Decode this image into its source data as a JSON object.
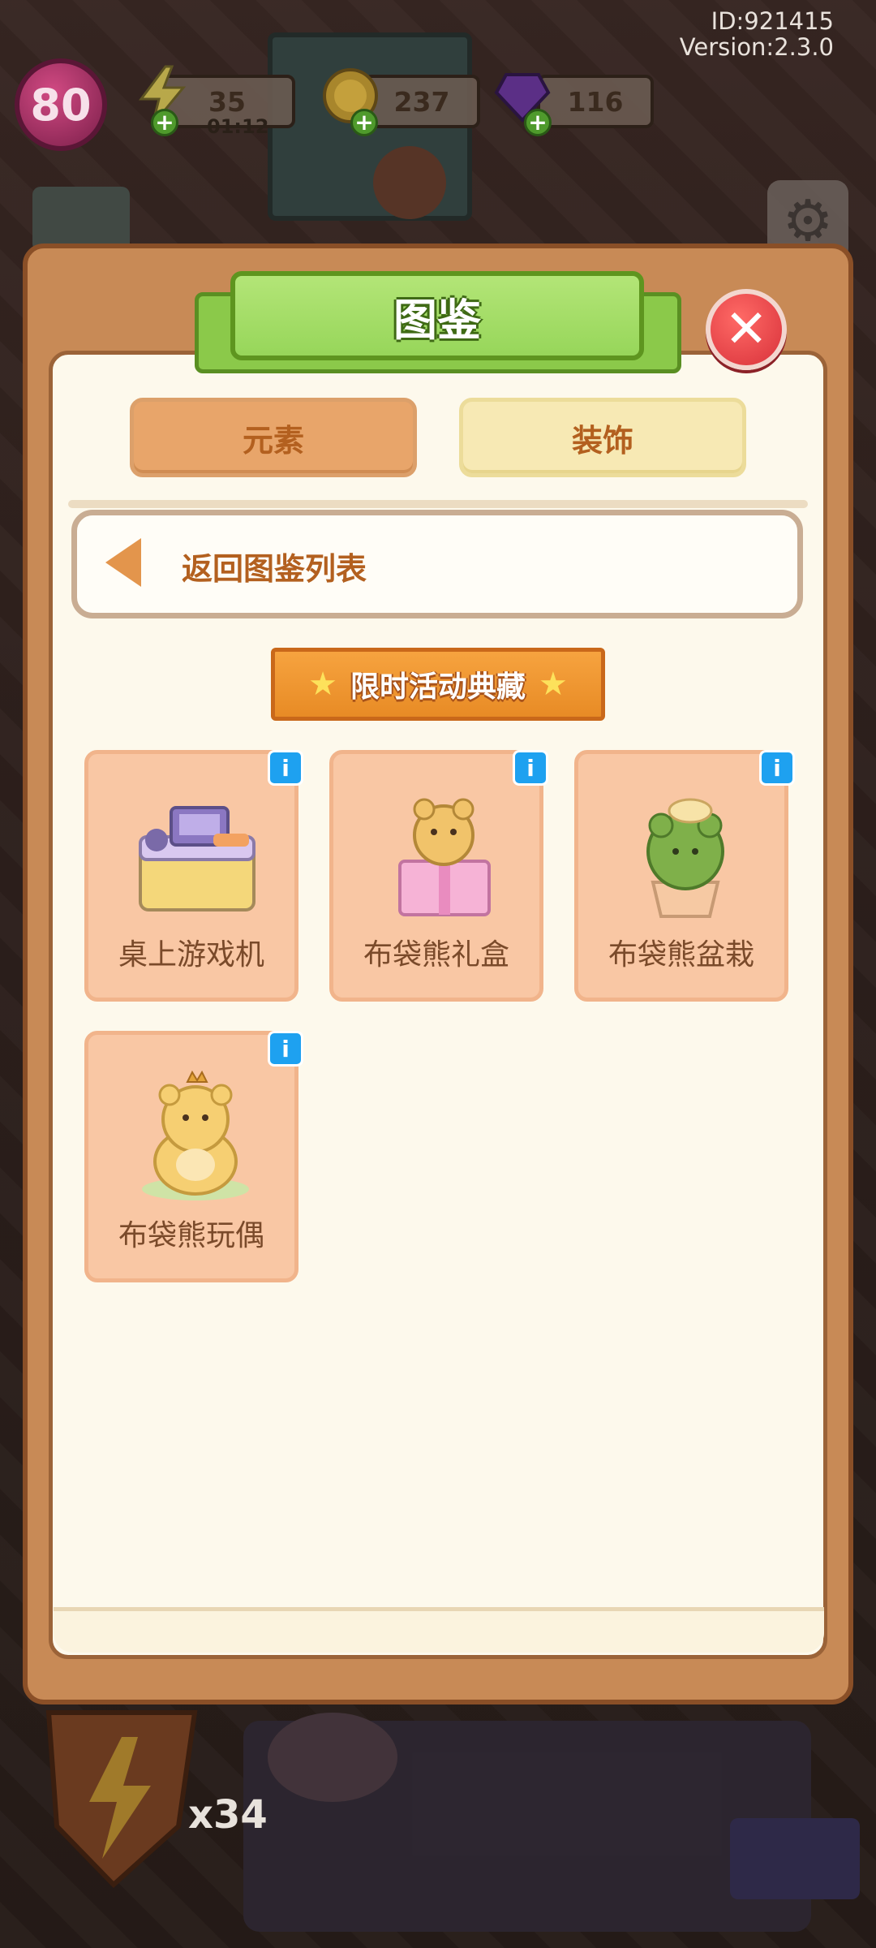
{
  "hud": {
    "id_text": "ID:921415",
    "version_text": "Version:2.3.0",
    "level": "80",
    "energy": "35",
    "energy_timer": "01:12",
    "coins": "237",
    "gems": "116"
  },
  "modal": {
    "title": "图鉴",
    "tabs": [
      {
        "label": "元素",
        "selected": false
      },
      {
        "label": "装饰",
        "selected": true
      }
    ],
    "back_label": "返回图鉴列表",
    "section_title": "限时活动典藏",
    "items": [
      {
        "label": "桌上游戏机",
        "icon": "game-console-desk-icon"
      },
      {
        "label": "布袋熊礼盒",
        "icon": "bear-gift-box-icon"
      },
      {
        "label": "布袋熊盆栽",
        "icon": "bear-potted-plant-icon"
      },
      {
        "label": "布袋熊玩偶",
        "icon": "bear-plush-toy-icon"
      }
    ]
  },
  "bottom": {
    "multiplier": "x34"
  },
  "colors": {
    "modal_frame": "#c88a56",
    "paper": "#fdf9ec",
    "title_green": "#97d65a",
    "accent_orange": "#e88b25",
    "card_peach": "#f9c7a4",
    "close_red": "#d8313a",
    "info_blue": "#1ea1f0"
  }
}
